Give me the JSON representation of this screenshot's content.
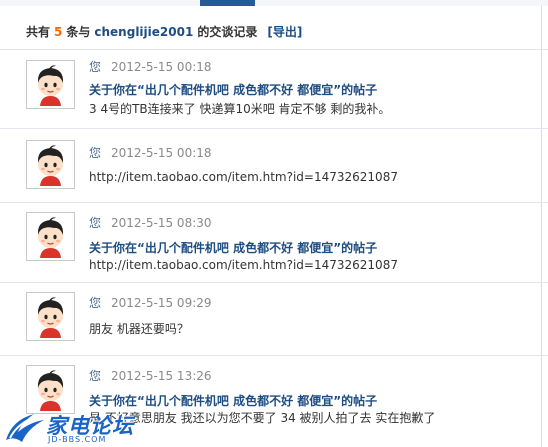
{
  "header": {
    "prefix": "共有",
    "count": "5",
    "mid": "条与",
    "username": "chenglijie2001",
    "suffix": "的交谈记录",
    "export_label": "[导出]"
  },
  "messages": [
    {
      "sender": "您",
      "time": "2012-5-15 00:18",
      "topic": "关于你在“出几个配件机吧 成色都不好 都便宜”的帖子",
      "text": "3 4号的TB连接来了 快递算10米吧 肯定不够 剩的我补。"
    },
    {
      "sender": "您",
      "time": "2012-5-15 00:18",
      "topic": "",
      "text": "http://item.taobao.com/item.htm?id=14732621087"
    },
    {
      "sender": "您",
      "time": "2012-5-15 08:30",
      "topic": "关于你在“出几个配件机吧 成色都不好 都便宜”的帖子",
      "text": "http://item.taobao.com/item.htm?id=14732621087"
    },
    {
      "sender": "您",
      "time": "2012-5-15 09:29",
      "topic": "",
      "text": "朋友 机器还要吗？"
    },
    {
      "sender": "您",
      "time": "2012-5-15 13:26",
      "topic": "关于你在“出几个配件机吧 成色都不好 都便宜”的帖子",
      "text": "是 不好意思朋友 我还以为您不要了 34 被别人拍了去 实在抱歉了"
    }
  ],
  "watermark": {
    "main": "家电论坛",
    "sub": "JD-BBS.COM"
  },
  "colors": {
    "link": "#1e4d82",
    "count": "#ff6600",
    "tab": "#2a5a94"
  }
}
